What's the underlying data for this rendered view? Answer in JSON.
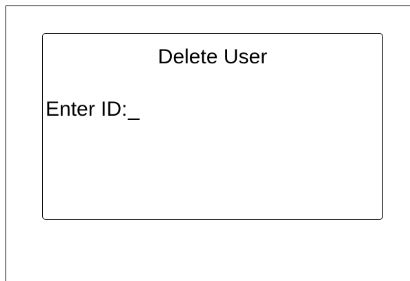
{
  "screen": {
    "outer_frame": true
  },
  "dialog": {
    "title": "Delete User",
    "prompt_label": "Enter ID:",
    "input_value": "",
    "cursor": "_"
  },
  "colors": {
    "background": "#ffffff",
    "foreground": "#000000"
  }
}
